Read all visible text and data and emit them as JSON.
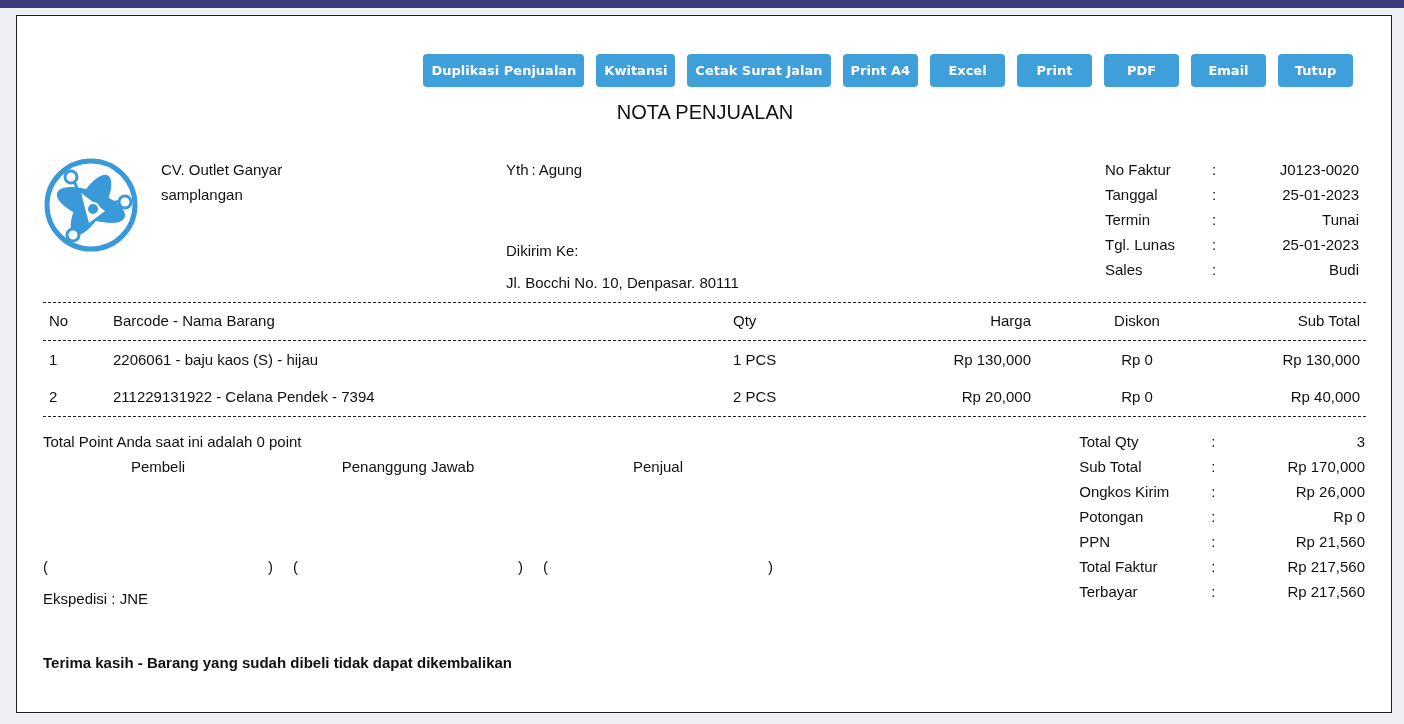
{
  "buttons": [
    "Duplikasi Penjualan",
    "Kwitansi",
    "Cetak Surat Jalan",
    "Print A4",
    "Excel",
    "Print",
    "PDF",
    "Email",
    "Tutup"
  ],
  "title": "NOTA PENJUALAN",
  "company": {
    "name": "CV. Outlet Ganyar",
    "address": "samplangan"
  },
  "recipient": {
    "label": "Yth",
    "separator": ":",
    "name": "Agung",
    "shipping_label": "Dikirim Ke:",
    "shipping_address": "Jl. Bocchi No. 10, Denpasar. 80111"
  },
  "invoice_info": [
    {
      "label": "No Faktur",
      "separator": ":",
      "value": "J0123-0020"
    },
    {
      "label": "Tanggal",
      "separator": ":",
      "value": "25-01-2023"
    },
    {
      "label": "Termin",
      "separator": ":",
      "value": "Tunai"
    },
    {
      "label": "Tgl. Lunas",
      "separator": ":",
      "value": "25-01-2023"
    },
    {
      "label": "Sales",
      "separator": ":",
      "value": "Budi"
    }
  ],
  "table": {
    "columns": [
      "No",
      "Barcode - Nama Barang",
      "Qty",
      "Harga",
      "Diskon",
      "Sub Total"
    ],
    "rows": [
      [
        "1",
        "2206061 - baju kaos (S) - hijau",
        "1 PCS",
        "Rp 130,000",
        "Rp 0",
        "Rp 130,000"
      ],
      [
        "2",
        "211229131922 - Celana Pendek - 7394",
        "2 PCS",
        "Rp 20,000",
        "Rp 0",
        "Rp 40,000"
      ]
    ]
  },
  "points_note": "Total Point Anda saat ini adalah 0 point",
  "signatures": [
    {
      "title": "Pembeli",
      "open": "(",
      "close": ")"
    },
    {
      "title": "Penanggung Jawab",
      "open": "(",
      "close": ")"
    },
    {
      "title": "Penjual",
      "open": "(",
      "close": ")"
    }
  ],
  "expedition": "Ekspedisi : JNE",
  "totals": [
    {
      "label": "Total Qty",
      "separator": ":",
      "value": "3"
    },
    {
      "label": "Sub Total",
      "separator": ":",
      "value": "Rp 170,000"
    },
    {
      "label": "Ongkos Kirim",
      "separator": ":",
      "value": "Rp 26,000"
    },
    {
      "label": "Potongan",
      "separator": ":",
      "value": "Rp 0"
    },
    {
      "label": "PPN",
      "separator": ":",
      "value": "Rp 21,560"
    },
    {
      "label": "Total Faktur",
      "separator": ":",
      "value": "Rp 217,560"
    },
    {
      "label": "Terbayar",
      "separator": ":",
      "value": "Rp 217,560"
    }
  ],
  "footer_note": "Terima kasih - Barang yang sudah dibeli tidak dapat dikembalikan"
}
